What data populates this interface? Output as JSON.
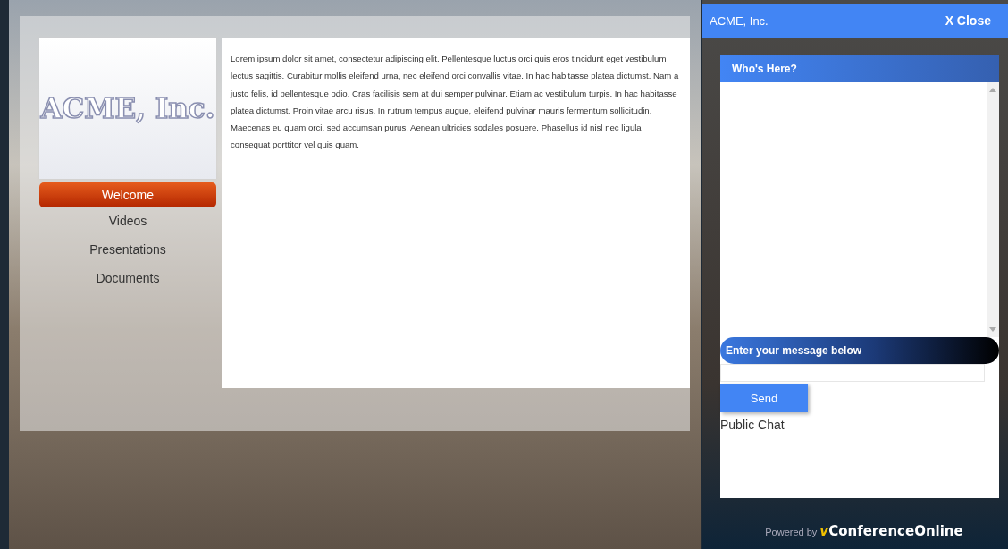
{
  "site": {
    "logo": "ACME, Inc.",
    "nav": [
      {
        "label": "Welcome",
        "selected": true
      },
      {
        "label": "Videos",
        "selected": false
      },
      {
        "label": "Presentations",
        "selected": false
      },
      {
        "label": "Documents",
        "selected": false
      }
    ],
    "content": "Lorem ipsum dolor sit amet, consectetur adipiscing elit. Pellentesque luctus orci quis eros tincidunt eget vestibulum lectus sagittis. Curabitur mollis eleifend urna, nec eleifend orci convallis vitae. In hac habitasse platea dictumst. Nam a justo felis, id pellentesque odio. Cras facilisis sem at dui semper pulvinar. Etiam ac vestibulum turpis. In hac habitasse platea dictumst. Proin vitae arcu risus. In rutrum tempus augue, eleifend pulvinar mauris fermentum sollicitudin. Maecenas eu quam orci, sed accumsan purus. Aenean ultricies sodales posuere. Phasellus id nisl nec ligula consequat porttitor vel quis quam."
  },
  "chat": {
    "title": "ACME, Inc.",
    "close": "X Close",
    "whos_here": "Who's Here?",
    "message_label": "Enter your message below",
    "send": "Send",
    "room": "Public Chat"
  },
  "footer": {
    "prefix": "Powered by",
    "brand": "vConferenceOnline"
  }
}
